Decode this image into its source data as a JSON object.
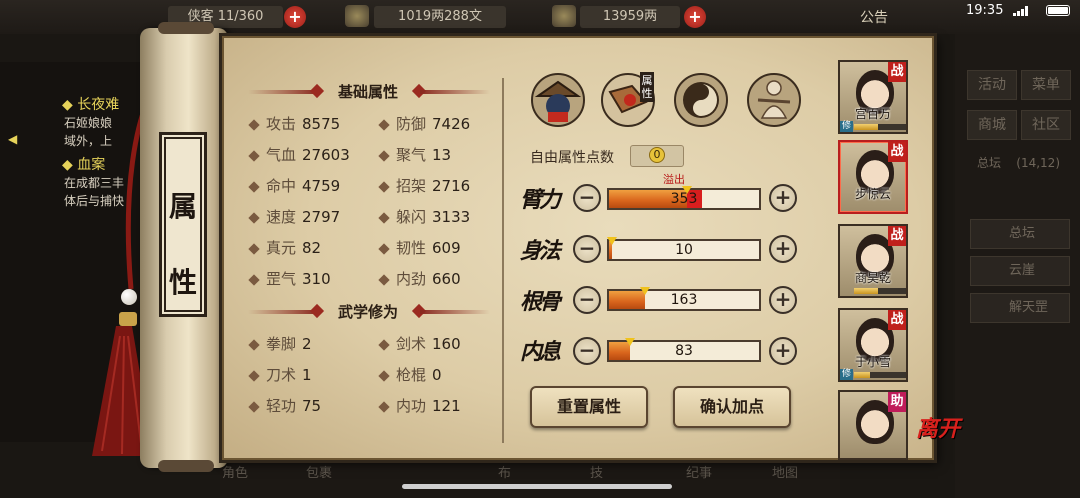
{
  "top_bar": {
    "stamina_partial": "侠客 11/360",
    "copper": "1019两288文",
    "silver": "13959两",
    "notice": "公告",
    "clock": "19:35"
  },
  "quests": [
    {
      "title": "长夜难",
      "lines": [
        "石姬娘娘",
        "域外，上"
      ]
    },
    {
      "title": "血案",
      "lines": [
        "在成都三丰",
        "体后与捕快"
      ]
    }
  ],
  "right_menu": {
    "buttons": [
      "活动",
      "菜单",
      "商城",
      "社区"
    ],
    "location": "总坛",
    "coords": "(14,12)",
    "wide_items": [
      "总坛",
      "云崖",
      "解天罡"
    ]
  },
  "bottom_bar": [
    "角色",
    "包裹",
    "布",
    "技",
    "纪事",
    "地图"
  ],
  "scroll_title": [
    "属",
    "性"
  ],
  "basic_section_title": "基础属性",
  "basic_stats": [
    {
      "label": "攻击",
      "value": "8575"
    },
    {
      "label": "防御",
      "value": "7426"
    },
    {
      "label": "气血",
      "value": "27603"
    },
    {
      "label": "聚气",
      "value": "13"
    },
    {
      "label": "命中",
      "value": "4759"
    },
    {
      "label": "招架",
      "value": "2716"
    },
    {
      "label": "速度",
      "value": "2797"
    },
    {
      "label": "躲闪",
      "value": "3133"
    },
    {
      "label": "真元",
      "value": "82"
    },
    {
      "label": "韧性",
      "value": "609"
    },
    {
      "label": "罡气",
      "value": "310"
    },
    {
      "label": "内劲",
      "value": "660"
    }
  ],
  "martial_section_title": "武学修为",
  "martial_stats": [
    {
      "label": "拳脚",
      "value": "2"
    },
    {
      "label": "剑术",
      "value": "160"
    },
    {
      "label": "刀术",
      "value": "1"
    },
    {
      "label": "枪棍",
      "value": "0"
    },
    {
      "label": "轻功",
      "value": "75"
    },
    {
      "label": "内功",
      "value": "121"
    }
  ],
  "tab_attr_label": "属性",
  "free_points_label": "自由属性点数",
  "free_points_value": "0",
  "overflow_label": "溢出",
  "attributes": [
    {
      "name": "臂力",
      "value": "353",
      "fill": 0.52,
      "over": 0.1
    },
    {
      "name": "身法",
      "value": "10",
      "fill": 0.02,
      "over": 0
    },
    {
      "name": "根骨",
      "value": "163",
      "fill": 0.24,
      "over": 0
    },
    {
      "name": "内息",
      "value": "83",
      "fill": 0.14,
      "over": 0
    }
  ],
  "reset_label": "重置属性",
  "confirm_label": "确认加点",
  "heroes": [
    {
      "name": "宫百万",
      "badge": "战",
      "xiu": "修",
      "xiu_level": 0.45
    },
    {
      "name": "步惊云",
      "badge": "战",
      "xiu": "",
      "xiu_level": 0
    },
    {
      "name": "商昊乾",
      "badge": "战",
      "xiu": "",
      "xiu_level": 0.45
    },
    {
      "name": "于小雪",
      "badge": "战",
      "xiu": "修",
      "xiu_level": 0.3
    },
    {
      "name": "",
      "badge": "助",
      "xiu": "",
      "xiu_level": 0
    }
  ],
  "leave_label": "离开",
  "colors": {
    "accent_red": "#c0201c",
    "bar_orange": "#d8641c",
    "paper": "#e4d4b0"
  }
}
